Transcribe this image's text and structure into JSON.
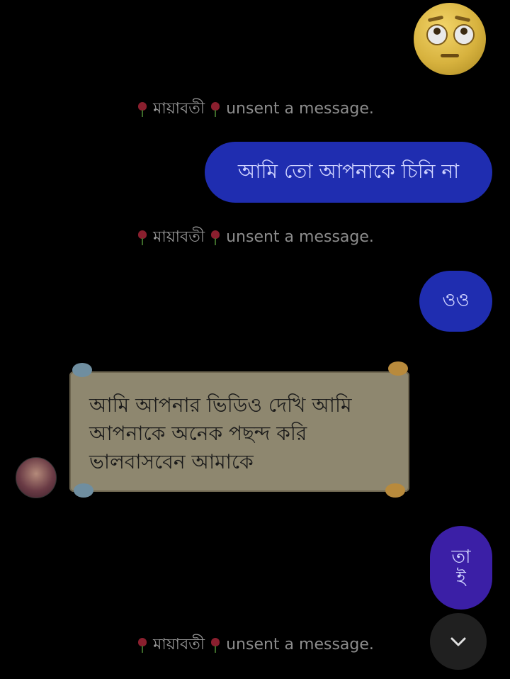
{
  "chat": {
    "unsent_name": "মায়াবতী",
    "unsent_text": "unsent a message.",
    "messages": {
      "out1": "আমি তো আপনাকে চিনি না",
      "out2": "ওও",
      "in_card_line1": "আমি আপনার ভিডিও দেখি আমি",
      "in_card_line2": "আপনাকে অনেক পছন্দ করি",
      "in_card_line3": "ভালবাসবেন আমাকে",
      "out3_line1": "তা",
      "out3_line2": "ই"
    }
  },
  "icons": {
    "emoji": "eye-roll-emoji-icon",
    "rose": "rose-icon",
    "scroll": "chevron-down-icon",
    "avatar": "contact-avatar"
  },
  "colors": {
    "background": "#000000",
    "outgoing_bubble": "#1f2db0",
    "outgoing_bubble_alt": "#3b1fa6",
    "card": "#8e876f",
    "unsent_text": "#8c8c8c"
  }
}
